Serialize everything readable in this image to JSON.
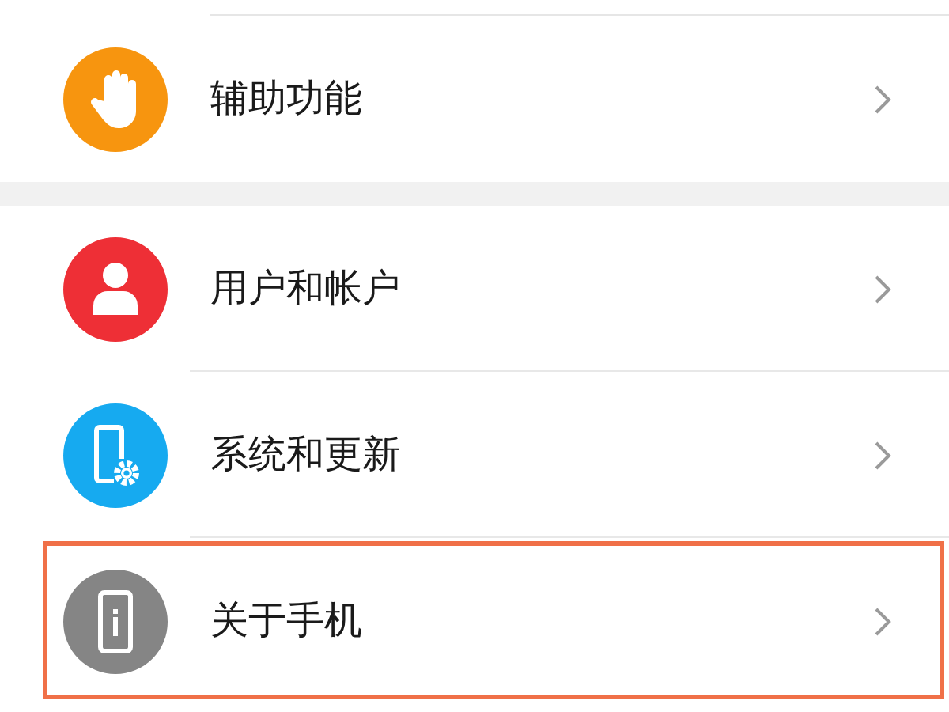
{
  "groups": [
    {
      "items": [
        {
          "label": "辅助功能",
          "kind": "hand",
          "color": "#f7950f",
          "highlighted": false
        }
      ]
    },
    {
      "items": [
        {
          "label": "用户和帐户",
          "kind": "person",
          "color": "#ee2f36",
          "highlighted": false
        },
        {
          "label": "系统和更新",
          "kind": "phone-gear",
          "color": "#16aaf0",
          "highlighted": false
        },
        {
          "label": "关于手机",
          "kind": "phone-info",
          "color": "#858585",
          "highlighted": true
        }
      ]
    }
  ]
}
